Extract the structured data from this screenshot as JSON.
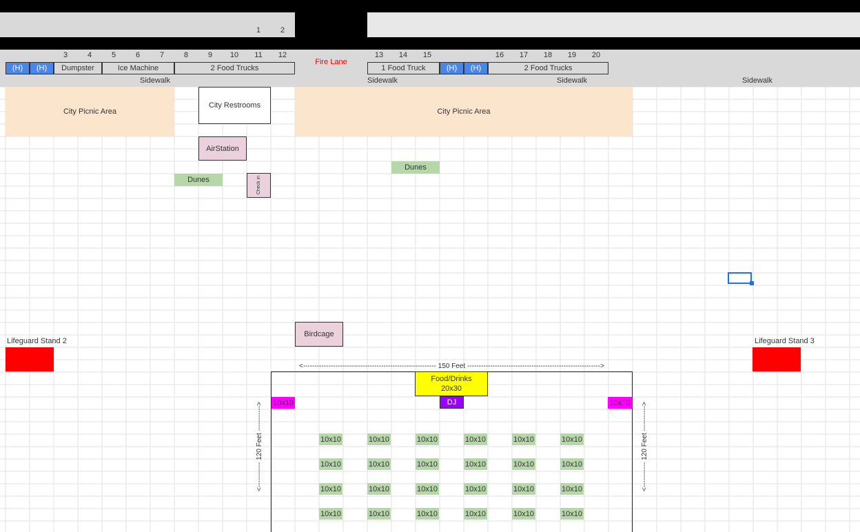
{
  "colors": {
    "black_bar": "#000000",
    "handicap": "#4a86e8",
    "picnic": "#fce5cd",
    "pink": "#ead1dc",
    "dunes": "#b6d7a8",
    "food": "#ffff00",
    "dj": "#9900ff",
    "magenta": "#ff00ff",
    "lifeguard": "#ff0000",
    "fire_lane_text": "#ff0000",
    "selection": "#1a73e8"
  },
  "top_numbers": [
    "1",
    "2"
  ],
  "spot_numbers": [
    "3",
    "4",
    "5",
    "6",
    "7",
    "8",
    "9",
    "10",
    "11",
    "12",
    "13",
    "14",
    "15",
    "16",
    "17",
    "18",
    "19",
    "20"
  ],
  "handicap_label": "(H)",
  "parking": {
    "dumpster": "Dumpster",
    "ice_machine": "Ice Machine",
    "food_trucks_a": "2 Food Trucks",
    "fire_lane": "Fire Lane",
    "food_truck_b": "1 Food Truck",
    "food_trucks_c": "2 Food Trucks"
  },
  "sidewalk_label": "Sidewalk",
  "areas": {
    "picnic_left": "City Picnic Area",
    "restrooms": "City Restrooms",
    "picnic_right": "City Picnic Area",
    "airstation": "AirStation",
    "dunes_right": "Dunes",
    "dunes_left": "Dunes",
    "checkin": "Check in",
    "birdcage": "Birdcage",
    "lifeguard_2": "Lifeguard Stand 2",
    "lifeguard_3": "Lifeguard Stand 3"
  },
  "venue": {
    "width_label": "<---------------------------------------------------------- 150 Feet ---------------------------------------------------------->",
    "height_label": "<----------- 120 Feet ----------->",
    "food": "Food/Drinks",
    "food_size": "20x30",
    "dj": "DJ",
    "side_booth": "10x10",
    "booth": "10x10"
  }
}
